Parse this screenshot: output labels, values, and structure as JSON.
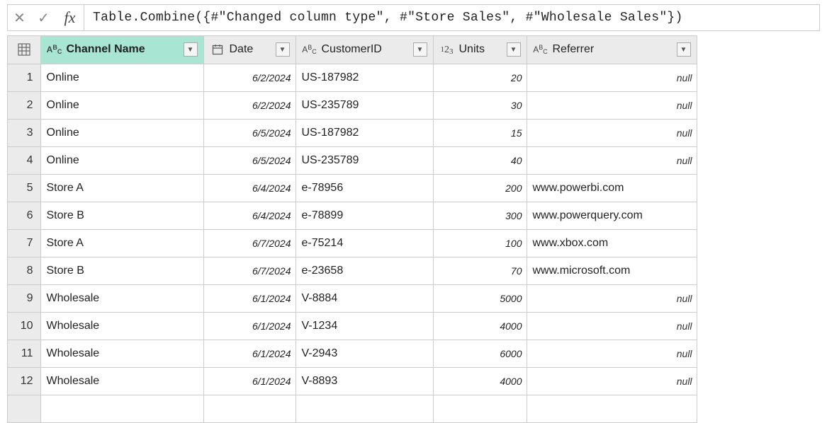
{
  "formulaBar": {
    "cancelIcon": "✕",
    "acceptIcon": "✓",
    "fxLabel": "fx",
    "formula": "Table.Combine({#\"Changed column type\", #\"Store Sales\", #\"Wholesale Sales\"})"
  },
  "columns": {
    "channel": "Channel Name",
    "date": "Date",
    "customer": "CustomerID",
    "units": "Units",
    "referrer": "Referrer"
  },
  "nullLabel": "null",
  "rows": [
    {
      "n": "1",
      "channel": "Online",
      "date": "6/2/2024",
      "cust": "US-187982",
      "units": "20",
      "ref": null
    },
    {
      "n": "2",
      "channel": "Online",
      "date": "6/2/2024",
      "cust": "US-235789",
      "units": "30",
      "ref": null
    },
    {
      "n": "3",
      "channel": "Online",
      "date": "6/5/2024",
      "cust": "US-187982",
      "units": "15",
      "ref": null
    },
    {
      "n": "4",
      "channel": "Online",
      "date": "6/5/2024",
      "cust": "US-235789",
      "units": "40",
      "ref": null
    },
    {
      "n": "5",
      "channel": "Store A",
      "date": "6/4/2024",
      "cust": "e-78956",
      "units": "200",
      "ref": "www.powerbi.com"
    },
    {
      "n": "6",
      "channel": "Store B",
      "date": "6/4/2024",
      "cust": "e-78899",
      "units": "300",
      "ref": "www.powerquery.com"
    },
    {
      "n": "7",
      "channel": "Store A",
      "date": "6/7/2024",
      "cust": "e-75214",
      "units": "100",
      "ref": "www.xbox.com"
    },
    {
      "n": "8",
      "channel": "Store B",
      "date": "6/7/2024",
      "cust": "e-23658",
      "units": "70",
      "ref": "www.microsoft.com"
    },
    {
      "n": "9",
      "channel": "Wholesale",
      "date": "6/1/2024",
      "cust": "V-8884",
      "units": "5000",
      "ref": null
    },
    {
      "n": "10",
      "channel": "Wholesale",
      "date": "6/1/2024",
      "cust": "V-1234",
      "units": "4000",
      "ref": null
    },
    {
      "n": "11",
      "channel": "Wholesale",
      "date": "6/1/2024",
      "cust": "V-2943",
      "units": "6000",
      "ref": null
    },
    {
      "n": "12",
      "channel": "Wholesale",
      "date": "6/1/2024",
      "cust": "V-8893",
      "units": "4000",
      "ref": null
    }
  ]
}
